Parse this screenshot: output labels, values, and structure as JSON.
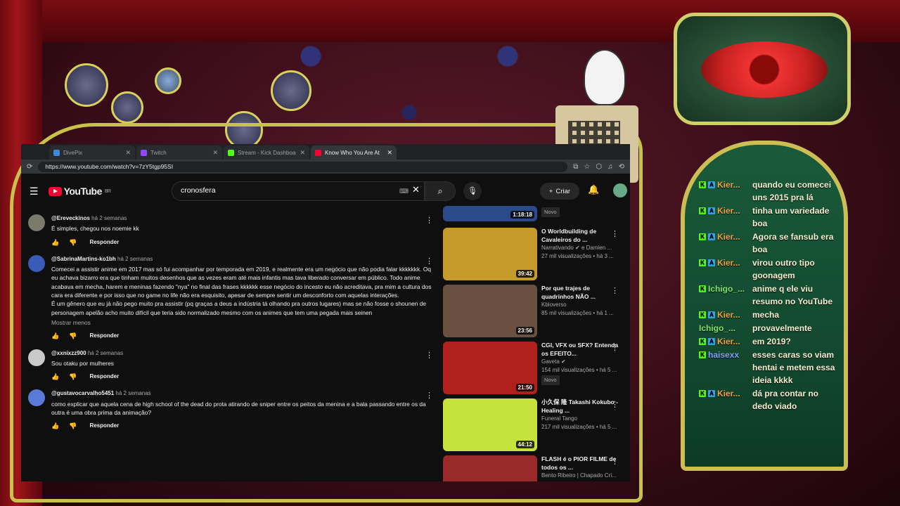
{
  "browser": {
    "tabs": [
      {
        "title": "DivePix",
        "color": "#3a8bd8",
        "active": false
      },
      {
        "title": "Twitch",
        "color": "#9146ff",
        "active": false
      },
      {
        "title": "Stream - Kick Dashboard",
        "color": "#53fc18",
        "active": false
      },
      {
        "title": "Know Who You Are At",
        "color": "#ff0033",
        "active": true
      }
    ],
    "url": "https://www.youtube.com/watch?v=7zY5tgp95SI"
  },
  "youtube": {
    "logo": "YouTube",
    "region": "BR",
    "search_query": "cronosfera",
    "create_label": "Criar"
  },
  "comments": [
    {
      "author": "@Ereveckinos",
      "time": "há 2 semanas",
      "text": "É simples, chegou nos noemie kk",
      "more": "",
      "reply": "Responder",
      "avatar_color": "#7a7a6a"
    },
    {
      "author": "@SabrinaMartins-ko1bh",
      "time": "há 2 semanas",
      "text": "Comecei a assistir anime em 2017 mas só fui acompanhar por temporada em 2019, e realmente era um negócio que não podia falar kkkkkkk. Oq eu achava bizarro era que tinham muitos desenhos que as vezes eram até mais infantis mas tava liberado conversar em público. Todo anime acabava em mecha, harem e meninas fazendo \"nya\" no final das frases kkkkkk esse negócio do incesto eu não acreditava, pra mim a cultura dos cara era diferente e por isso que no game no life não era esquisito, apesar de sempre sentir um desconforto com aquelas interações.\nÉ um gênero que eu já não pego muito pra assistir (pq graças a deus a indústria tá olhando pra outros lugares) mas se não fosse o shounen de personagem apelão acho muito difícil que teria sido normalizado mesmo com os animes que tem uma pegada mais seinen",
      "more": "Mostrar menos",
      "reply": "Responder",
      "avatar_color": "#3b5bb8"
    },
    {
      "author": "@xxnixzz900",
      "time": "há 2 semanas",
      "text": "Sou otaku por mulheres",
      "more": "",
      "reply": "Responder",
      "avatar_color": "#c9c9c9"
    },
    {
      "author": "@gustavocarvalho5451",
      "time": "há 2 semanas",
      "text": "como explicar que aquela cena de high school of the dead do prota atirando de sniper entre os peitos da menina e a bala passando entre os da outra é uma obra prima da animação?",
      "more": "",
      "reply": "Responder",
      "avatar_color": "#5a7ad8"
    }
  ],
  "sidebar": {
    "top_stub": {
      "duration": "1:18:18",
      "badge": "Novo"
    },
    "videos": [
      {
        "title": "O Worldbuilding de Cavaleiros do ...",
        "channel": "Narrativando ✔ e Damien ...",
        "views": "27 mil visualizações • há 3 ...",
        "duration": "39:42",
        "badge": "",
        "thumb": "#c79a2c"
      },
      {
        "title": "Por que trajes de quadrinhos NÃO ...",
        "channel": "Kbloverso",
        "views": "85 mil visualizações • há 1 ...",
        "duration": "23:56",
        "badge": "",
        "thumb": "#6a5040"
      },
      {
        "title": "CGI, VFX ou SFX? Entenda os EFEITO...",
        "channel": "Gaveta ✔",
        "views": "154 mil visualizações • há 5 ...",
        "duration": "21:50",
        "badge": "Novo",
        "thumb": "#b0201c"
      },
      {
        "title": "小久保 隆 Takashi Kokubo - Healing ...",
        "channel": "Funeral Tango",
        "views": "217 mil visualizações • há 5 ...",
        "duration": "44:12",
        "badge": "",
        "thumb": "#c6e23c"
      },
      {
        "title": "FLASH é o PIOR FILME de todos os ...",
        "channel": "Bento Ribeiro | Chapado Crí...",
        "views": "",
        "duration": "",
        "badge": "",
        "thumb": "#9a2a2a"
      }
    ]
  },
  "chat": {
    "messages": [
      {
        "name": "Kier...",
        "badges": [
          "K",
          "A"
        ],
        "color": "#f0a040",
        "text": "quando eu comecei uns 2015 pra lá"
      },
      {
        "name": "Kier...",
        "badges": [
          "K",
          "A"
        ],
        "color": "#f0a040",
        "text": "tinha um variedade boa"
      },
      {
        "name": "Kier...",
        "badges": [
          "K",
          "A"
        ],
        "color": "#f0a040",
        "text": "Agora se fansub era boa"
      },
      {
        "name": "Kier...",
        "badges": [
          "K",
          "A"
        ],
        "color": "#f0a040",
        "text": "virou outro tipo goonagem"
      },
      {
        "name": "Ichigo_...",
        "badges": [
          "K"
        ],
        "color": "#7fe06a",
        "text": "anime q ele viu resumo no YouTube"
      },
      {
        "name": "Kier...",
        "badges": [
          "K",
          "A"
        ],
        "color": "#f0a040",
        "text": "mecha"
      },
      {
        "name": "Ichigo_...",
        "badges": [],
        "color": "#7fe06a",
        "text": "provavelmente"
      },
      {
        "name": "Kier...",
        "badges": [
          "K",
          "A"
        ],
        "color": "#f0a040",
        "text": "em 2019?"
      },
      {
        "name": "haisexx",
        "badges": [
          "K"
        ],
        "color": "#7fa0ff",
        "text": "esses caras so viam hentai e metem essa ideia kkkk"
      },
      {
        "name": "Kier...",
        "badges": [
          "K",
          "A"
        ],
        "color": "#f0a040",
        "text": "dá pra contar no dedo viado"
      }
    ]
  }
}
